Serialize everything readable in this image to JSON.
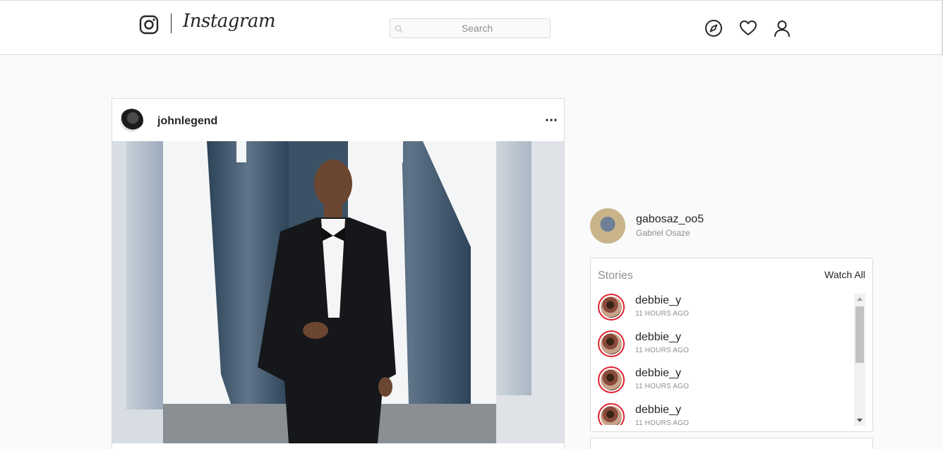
{
  "header": {
    "brand": "Instagram",
    "search_placeholder": "Search",
    "icons": [
      "instagram-glyph-icon",
      "search-icon",
      "compass-icon",
      "heart-icon",
      "user-icon"
    ]
  },
  "post": {
    "username": "johnlegend",
    "more_icon": "more-horizontal-icon"
  },
  "current_user": {
    "username": "gabosaz_oo5",
    "full_name": "Gabriel Osaze"
  },
  "stories": {
    "title": "Stories",
    "watch_all": "Watch All",
    "items": [
      {
        "username": "debbie_y",
        "time": "11 HOURS AGO"
      },
      {
        "username": "debbie_y",
        "time": "11 HOURS AGO"
      },
      {
        "username": "debbie_y",
        "time": "11 HOURS AGO"
      },
      {
        "username": "debbie_y",
        "time": "11 HOURS AGO"
      }
    ]
  },
  "colors": {
    "story_ring": "#e0202f",
    "border": "#dbdbdb",
    "muted_text": "#8e8e8e",
    "text": "#262626"
  }
}
